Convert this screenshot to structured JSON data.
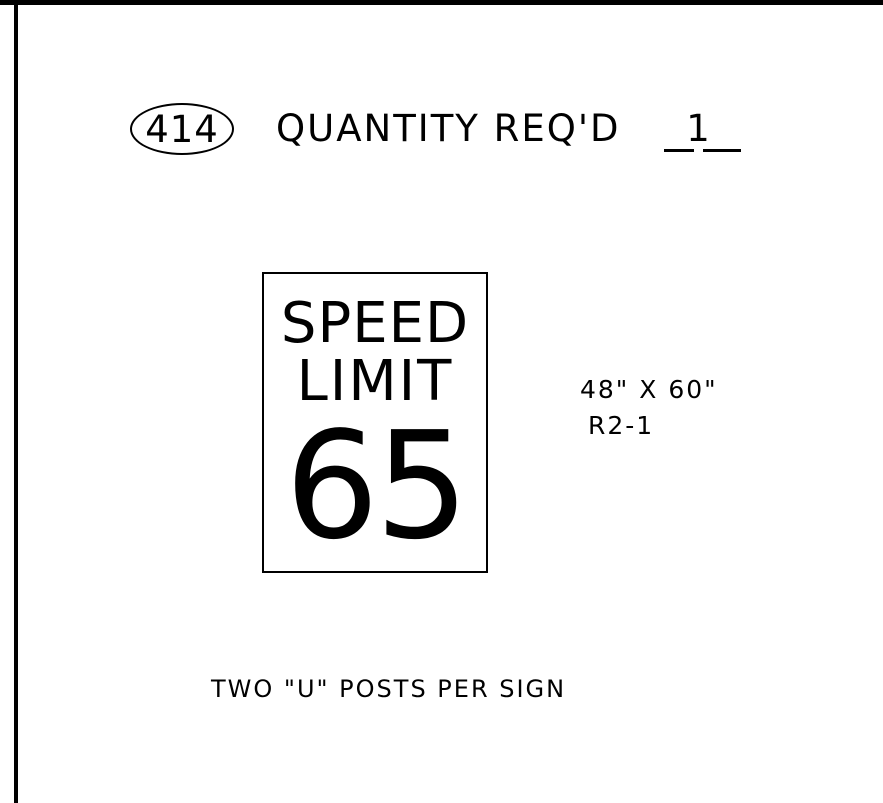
{
  "sheet": {
    "item_number": "414",
    "quantity_label": "QUANTITY REQ'D",
    "quantity_value": "1"
  },
  "sign": {
    "line1": "SPEED",
    "line2": "LIMIT",
    "speed": "65"
  },
  "sign_info": {
    "size": "48\" X 60\"",
    "code": "R2-1"
  },
  "notes": {
    "posts": "TWO \"U\" POSTS PER SIGN"
  }
}
